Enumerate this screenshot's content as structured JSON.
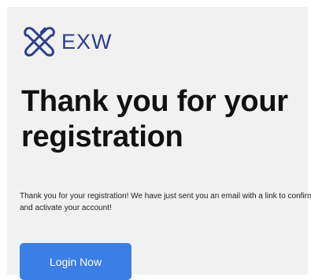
{
  "brand": {
    "name": "EXW",
    "logo_icon": "interlocked-loops-logo-icon",
    "color": "#2d3e8c"
  },
  "headline": "Thank you for your registration",
  "message": "Thank you for your registration! We have just sent you an email with a link to confirm and activate your account!",
  "login_button": {
    "label": "Login Now",
    "color": "#3b7ee6"
  }
}
